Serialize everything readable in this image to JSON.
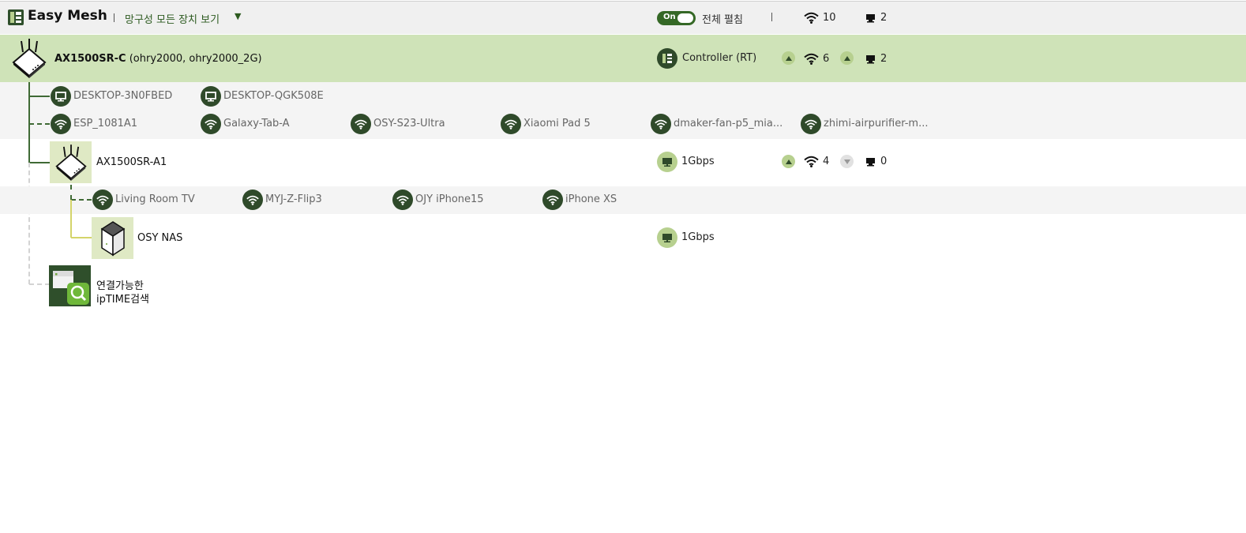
{
  "header": {
    "app_title": "Easy Mesh",
    "view_label": "망구성 모든 장치 보기",
    "toggle_state": "On",
    "expand_all_label": "전체 펼침",
    "wifi_total": "10",
    "lan_total": "2"
  },
  "controller": {
    "name": "AX1500SR-C",
    "ssids": "(ohry2000, ohry2000_2G)",
    "role": "Controller (RT)",
    "wifi_count": "6",
    "lan_count": "2",
    "lan_clients": [
      "DESKTOP-3N0FBED",
      "DESKTOP-QGK508E"
    ],
    "wifi_clients": [
      "ESP_1081A1",
      "Galaxy-Tab-A",
      "OSY-S23-Ultra",
      "Xiaomi Pad 5",
      "dmaker-fan-p5_mia...",
      "zhimi-airpurifier-m..."
    ]
  },
  "agent": {
    "name": "AX1500SR-A1",
    "link_speed": "1Gbps",
    "wifi_count": "4",
    "lan_count": "0",
    "wifi_clients": [
      "Living Room TV",
      "MYJ-Z-Flip3",
      "OJY iPhone15",
      "iPhone XS"
    ]
  },
  "nas": {
    "name": "OSY NAS",
    "link_speed": "1Gbps"
  },
  "search": {
    "label_line1": "연결가능한",
    "label_line2": "ipTIME검색"
  },
  "colors": {
    "accent_dark": "#2f4a2a",
    "row_highlight": "#cfe3b8",
    "badge_light": "#b7d08f"
  }
}
